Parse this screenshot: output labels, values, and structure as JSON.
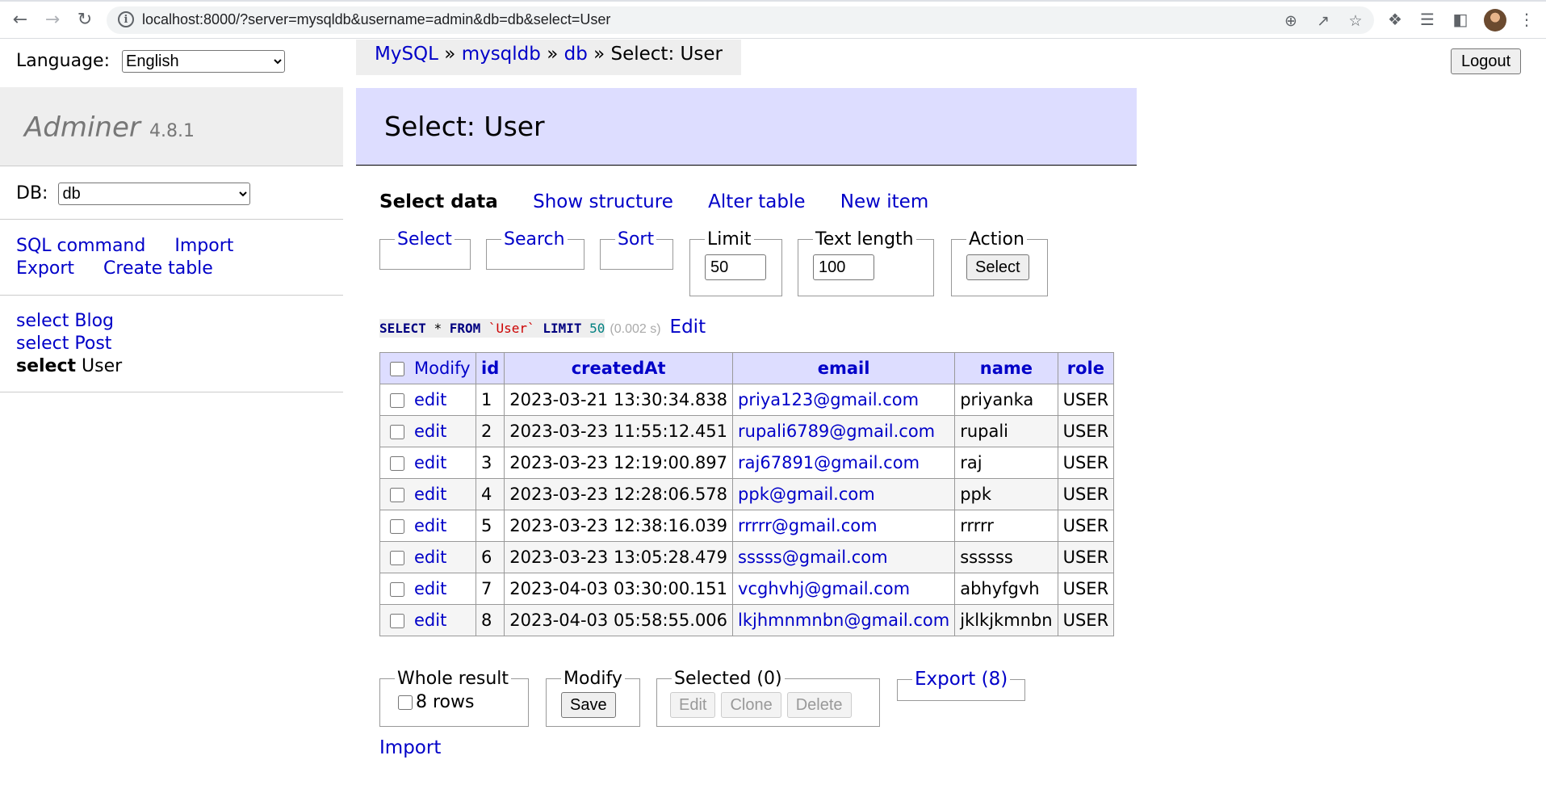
{
  "browser": {
    "url": "localhost:8000/?server=mysqldb&username=admin&db=db&select=User"
  },
  "language": {
    "label": "Language:",
    "selected": "English"
  },
  "sidebar": {
    "brand": "Adminer",
    "version": "4.8.1",
    "db_label": "DB:",
    "db_selected": "db",
    "links": {
      "sql_command": "SQL command",
      "import": "Import",
      "export": "Export",
      "create_table": "Create table"
    },
    "tables": [
      {
        "prefix": "select",
        "name": "Blog"
      },
      {
        "prefix": "select",
        "name": "Post"
      },
      {
        "prefix": "select",
        "name": "User"
      }
    ]
  },
  "breadcrumb": {
    "server": "MySQL",
    "host": "mysqldb",
    "db": "db",
    "current": "Select: User",
    "sep": "»"
  },
  "logout_label": "Logout",
  "page_title": "Select: User",
  "tabs": {
    "select_data": "Select data",
    "show_structure": "Show structure",
    "alter_table": "Alter table",
    "new_item": "New item"
  },
  "filters": {
    "select": "Select",
    "search": "Search",
    "sort": "Sort",
    "limit_label": "Limit",
    "limit_value": "50",
    "text_length_label": "Text length",
    "text_length_value": "100",
    "action_label": "Action",
    "action_button": "Select"
  },
  "query": {
    "select": "SELECT",
    "star": "*",
    "from": "FROM",
    "table": "`User`",
    "limit": "LIMIT",
    "limit_value": "50",
    "time": "(0.002 s)",
    "edit_link": "Edit"
  },
  "table": {
    "modify_header": "Modify",
    "columns": [
      "id",
      "createdAt",
      "email",
      "name",
      "role"
    ],
    "edit_label": "edit",
    "rows": [
      {
        "id": "1",
        "createdAt": "2023-03-21 13:30:34.838",
        "email": "priya123@gmail.com",
        "name": "priyanka",
        "role": "USER"
      },
      {
        "id": "2",
        "createdAt": "2023-03-23 11:55:12.451",
        "email": "rupali6789@gmail.com",
        "name": "rupali",
        "role": "USER"
      },
      {
        "id": "3",
        "createdAt": "2023-03-23 12:19:00.897",
        "email": "raj67891@gmail.com",
        "name": "raj",
        "role": "USER"
      },
      {
        "id": "4",
        "createdAt": "2023-03-23 12:28:06.578",
        "email": "ppk@gmail.com",
        "name": "ppk",
        "role": "USER"
      },
      {
        "id": "5",
        "createdAt": "2023-03-23 12:38:16.039",
        "email": "rrrrr@gmail.com",
        "name": "rrrrr",
        "role": "USER"
      },
      {
        "id": "6",
        "createdAt": "2023-03-23 13:05:28.479",
        "email": "sssss@gmail.com",
        "name": "ssssss",
        "role": "USER"
      },
      {
        "id": "7",
        "createdAt": "2023-04-03 03:30:00.151",
        "email": "vcghvhj@gmail.com",
        "name": "abhyfgvh",
        "role": "USER"
      },
      {
        "id": "8",
        "createdAt": "2023-04-03 05:58:55.006",
        "email": "lkjhmnmnbn@gmail.com",
        "name": "jklkjkmnbn",
        "role": "USER"
      }
    ]
  },
  "bottom": {
    "whole_result_label": "Whole result",
    "rows_label": "8 rows",
    "modify_label": "Modify",
    "save_button": "Save",
    "selected_label": "Selected (0)",
    "edit_button": "Edit",
    "clone_button": "Clone",
    "delete_button": "Delete",
    "export_label": "Export (8)",
    "import_link": "Import"
  },
  "colors": {
    "link": "#0000c8",
    "header_band": "#ddddff",
    "sidebar_head": "#eeeeee"
  }
}
